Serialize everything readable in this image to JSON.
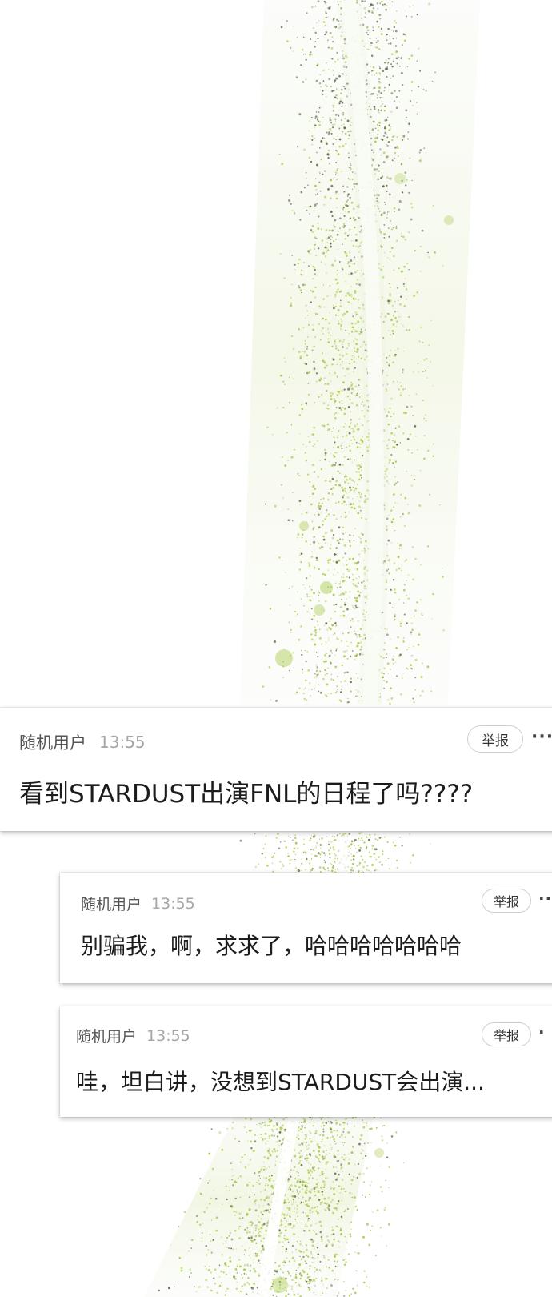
{
  "comments": [
    {
      "user": "随机用户",
      "time": "13:55",
      "report_label": "举报",
      "more_label": "···",
      "text": "看到STARDUST出演FNL的日程了吗????"
    },
    {
      "user": "随机用户",
      "time": "13:55",
      "report_label": "举报",
      "more_label": "··",
      "text": "别骗我，啊，求求了，哈哈哈哈哈哈哈"
    },
    {
      "user": "随机用户",
      "time": "13:55",
      "report_label": "举报",
      "more_label": "·",
      "text": "哇，坦白讲，没想到STARDUST会出演..."
    }
  ],
  "colors": {
    "accent_green": "#a8c94a",
    "dust_dark": "#5b6b4c",
    "username": "#555555",
    "timestamp": "#a6a6a6"
  }
}
